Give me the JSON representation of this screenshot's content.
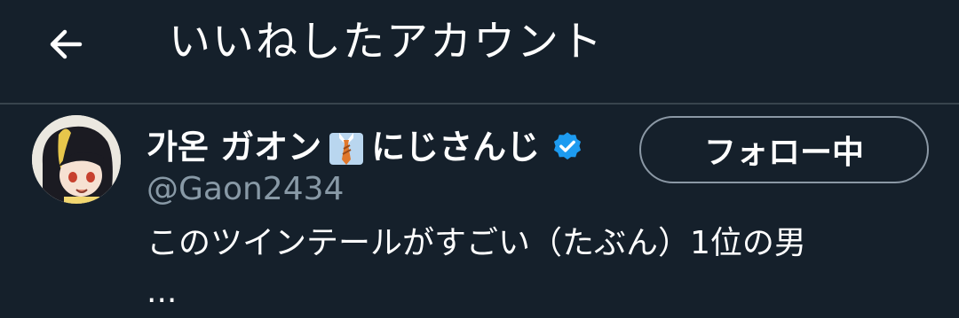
{
  "header": {
    "title": "いいねしたアカウント",
    "back_icon": "arrow-left-icon"
  },
  "user": {
    "name_prefix": "가온 ガオン",
    "name_emoji": "necktie-shirt-emoji",
    "name_suffix": "にじさんじ",
    "verified_icon": "verified-badge-icon",
    "handle": "@Gaon2434",
    "bio": "このツインテールがすごい（たぶん）1位の男",
    "bio_more": "...",
    "follow_button_label": "フォロー中"
  },
  "colors": {
    "background": "#15202b",
    "divider": "#38444d",
    "secondary_text": "#8899a6",
    "verified": "#1d9bf0",
    "button_border": "#8b98a5"
  }
}
